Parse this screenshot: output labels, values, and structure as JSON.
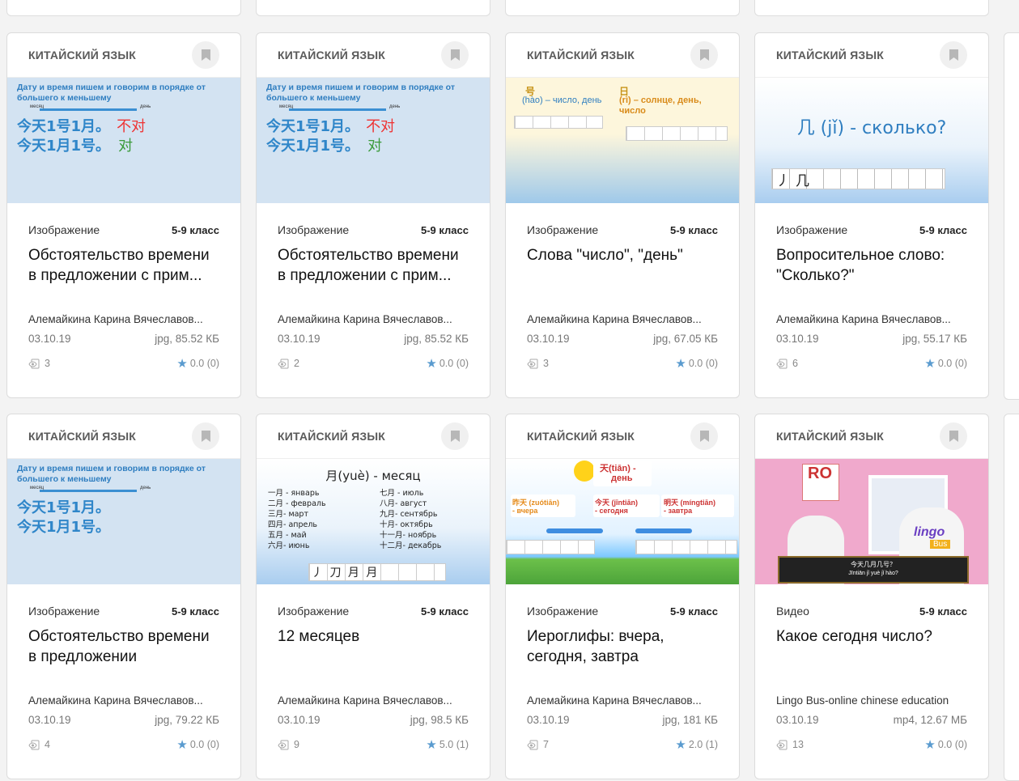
{
  "cards": [
    {
      "subject": "КИТАЙСКИЙ ЯЗЫК",
      "type": "Изображение",
      "grade": "5-9 класс",
      "title": "Обстоятельство времени в предложении с прим...",
      "author": "Алемайкина Карина Вячеславов...",
      "date": "03.10.19",
      "file": "jpg, 85.52 КБ",
      "views": "3",
      "rating": "0.0 (0)"
    },
    {
      "subject": "КИТАЙСКИЙ ЯЗЫК",
      "type": "Изображение",
      "grade": "5-9 класс",
      "title": "Обстоятельство времени в предложении с прим...",
      "author": "Алемайкина Карина Вячеславов...",
      "date": "03.10.19",
      "file": "jpg, 85.52 КБ",
      "views": "2",
      "rating": "0.0 (0)"
    },
    {
      "subject": "КИТАЙСКИЙ ЯЗЫК",
      "type": "Изображение",
      "grade": "5-9 класс",
      "title": "Слова \"число\", \"день\"",
      "author": "Алемайкина Карина Вячеславов...",
      "date": "03.10.19",
      "file": "jpg, 67.05 КБ",
      "views": "3",
      "rating": "0.0 (0)"
    },
    {
      "subject": "КИТАЙСКИЙ ЯЗЫК",
      "type": "Изображение",
      "grade": "5-9 класс",
      "title": "Вопросительное слово: \"Сколько?\"",
      "author": "Алемайкина Карина Вячеславов...",
      "date": "03.10.19",
      "file": "jpg, 55.17 КБ",
      "views": "6",
      "rating": "0.0 (0)"
    },
    {
      "subject": "КИТАЙСКИЙ ЯЗЫК",
      "type": "Изображение",
      "grade": "5-9 класс",
      "title": "Обстоятельство времени в предложении",
      "author": "Алемайкина Карина Вячеславов...",
      "date": "03.10.19",
      "file": "jpg, 79.22 КБ",
      "views": "4",
      "rating": "0.0 (0)"
    },
    {
      "subject": "КИТАЙСКИЙ ЯЗЫК",
      "type": "Изображение",
      "grade": "5-9 класс",
      "title": "12 месяцев",
      "author": "Алемайкина Карина Вячеславов...",
      "date": "03.10.19",
      "file": "jpg, 98.5 КБ",
      "views": "9",
      "rating": "5.0 (1)"
    },
    {
      "subject": "КИТАЙСКИЙ ЯЗЫК",
      "type": "Изображение",
      "grade": "5-9 класс",
      "title": "Иероглифы: вчера, сегодня, завтра",
      "author": "Алемайкина Карина Вячеславов...",
      "date": "03.10.19",
      "file": "jpg, 181 КБ",
      "views": "7",
      "rating": "2.0 (1)"
    },
    {
      "subject": "КИТАЙСКИЙ ЯЗЫК",
      "type": "Видео",
      "grade": "5-9 класс",
      "title": "Какое сегодня число?",
      "author": "Lingo Bus-online chinese education",
      "date": "03.10.19",
      "file": "mp4, 12.67 МБ",
      "views": "13",
      "rating": "0.0 (0)"
    }
  ],
  "thumbs": {
    "t1": {
      "line1": "Дату и время пишем и говорим в порядке от",
      "line2": "большего к меньшему",
      "small1": "месяц",
      "small2": "день",
      "cn1": "今天1号1月。",
      "cn1b": "不对",
      "cn2": "今天1月1号。",
      "cn2b": "对"
    },
    "t3": {
      "l1": "号",
      "l2": "(hào) – число, день",
      "r1": "日",
      "r2": "(rì) – солнце, день,",
      "r3": "число"
    },
    "t4": {
      "text": "几 (jǐ) - сколько?",
      "g1": "丿",
      "g2": "几"
    },
    "t6": {
      "title": "月(yuè) - месяц",
      "left": [
        "一月 - январь",
        "二月 - февраль",
        "三月- март",
        "四月- апрель",
        "五月 - май",
        "六月- июнь"
      ],
      "right": [
        "七月 - июль",
        "八月- август",
        "九月- сентябрь",
        "十月- октябрь",
        "十一月- ноябрь",
        "十二月- декабрь"
      ],
      "strokes": "丿 刀 月 月"
    },
    "t7": {
      "top": "天(tiān) -",
      "top2": "день",
      "a": "昨天 (zuótiān)",
      "a2": "- вчера",
      "b": "今天 (jīntiān)",
      "b2": "- сегодня",
      "c": "明天 (míngtiān)",
      "c2": "- завтра"
    },
    "t8": {
      "sign": "RO",
      "sub1": "今天几月几号？",
      "sub2": "Jīntiān jǐ yuè jǐ hào?",
      "logo": "lingo",
      "logo2": "Bus"
    }
  },
  "colors": {
    "accent": "#5a9bcf",
    "blue_text": "#2f7ec0"
  }
}
